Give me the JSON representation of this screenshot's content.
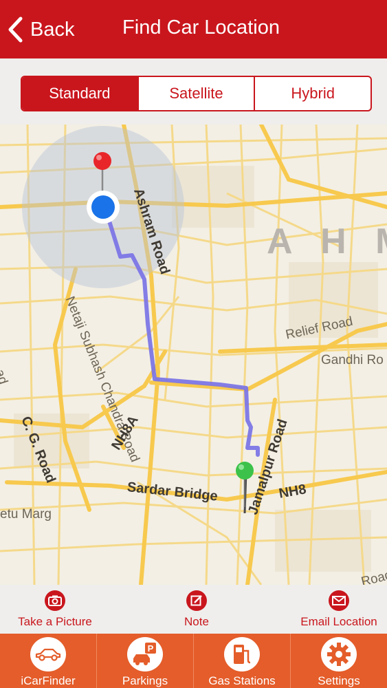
{
  "header": {
    "back_label": "Back",
    "title": "Find Car Location"
  },
  "map_types": [
    "Standard",
    "Satellite",
    "Hybrid"
  ],
  "map": {
    "labels": {
      "city": "A H M",
      "ashram_road": "Ashram Road",
      "netaji_road": "Netaji Subhash Chandra Road",
      "relief_road": "Relief Road",
      "gandhi_road": "Gandhi Ro",
      "jamalpur_road": "Jamalpur Road",
      "nh8a": "NH8A",
      "cg_road": "C. G. Road",
      "sardar_bridge": "Sardar Bridge",
      "nh8": "NH8",
      "setu_marg": "etu Marg",
      "edge_road": "Road",
      "left_edge": "ad"
    }
  },
  "actions": [
    {
      "label": "Take a Picture",
      "icon": "camera-icon"
    },
    {
      "label": "Note",
      "icon": "note-icon"
    },
    {
      "label": "Email Location",
      "icon": "email-icon"
    }
  ],
  "tabs": [
    {
      "label": "iCarFinder",
      "icon": "car-icon"
    },
    {
      "label": "Parkings",
      "icon": "parking-icon"
    },
    {
      "label": "Gas Stations",
      "icon": "gas-station-icon"
    },
    {
      "label": "Settings",
      "icon": "gear-icon"
    }
  ],
  "colors": {
    "header": "#c9161d",
    "tab_bar": "#e45d2a",
    "route": "#7a73e6",
    "roads": "#f5cf6a",
    "current_location": "#1a73e8",
    "car_pin": "#3cc24a",
    "destination_pin": "#e8262a"
  }
}
